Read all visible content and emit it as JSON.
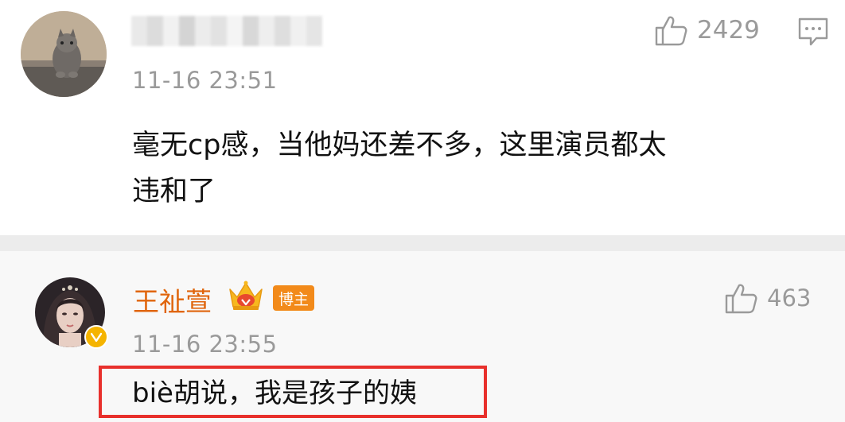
{
  "comments": [
    {
      "username": "",
      "timestamp": "11-16 23:51",
      "text_line1": "毫无cp感，当他妈还差不多，这里演员都太",
      "text_line2": "违和了",
      "likes": "2429"
    }
  ],
  "reply": {
    "author": "王祉萱",
    "badge": "博主",
    "timestamp": "11-16 23:55",
    "text": "biè胡说，我是孩子的姨",
    "likes": "463"
  },
  "icons": {
    "like": "thumbs-up-icon",
    "reply": "comment-icon",
    "crown": "crown-icon",
    "verified": "verified-v-icon"
  },
  "colors": {
    "author_name": "#e0650c",
    "badge_bg": "#f28a1a",
    "highlight_border": "#e8302c",
    "muted": "#9a9a9a",
    "verified": "#f5b400"
  }
}
